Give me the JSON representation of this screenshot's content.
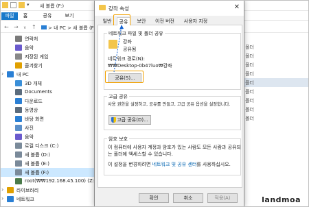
{
  "explorer": {
    "title": "새 볼륨 (F:)",
    "ribbon_tabs": [
      "파일",
      "홈",
      "공유",
      "보기"
    ],
    "address_path": "> 내 PC > 새 볼륨 (F:)",
    "sidebar": [
      {
        "label": "연락처",
        "icon": "contacts-icon",
        "color": "#7a7a7a",
        "indent": 1
      },
      {
        "label": "음악",
        "icon": "music-icon",
        "color": "#6a5acd",
        "indent": 1
      },
      {
        "label": "저장된 게임",
        "icon": "saved-games-icon",
        "color": "#888888",
        "indent": 1
      },
      {
        "label": "즐겨찾기",
        "icon": "favorites-icon",
        "color": "#e0a000",
        "indent": 1
      },
      {
        "label": "내 PC",
        "icon": "pc-icon",
        "color": "#2a7fd4",
        "indent": 0
      },
      {
        "label": "3D 개체",
        "icon": "3d-objects-icon",
        "color": "#3a8fd8",
        "indent": 1
      },
      {
        "label": "Documents",
        "icon": "documents-icon",
        "color": "#5b6c7d",
        "indent": 1
      },
      {
        "label": "다운로드",
        "icon": "downloads-icon",
        "color": "#2a7fd4",
        "indent": 1
      },
      {
        "label": "동영상",
        "icon": "videos-icon",
        "color": "#5b6c7d",
        "indent": 1
      },
      {
        "label": "바탕 화면",
        "icon": "desktop-icon",
        "color": "#2a7fd4",
        "indent": 1
      },
      {
        "label": "사진",
        "icon": "pictures-icon",
        "color": "#5b8fc9",
        "indent": 1
      },
      {
        "label": "음악",
        "icon": "music-icon",
        "color": "#6a5acd",
        "indent": 1
      },
      {
        "label": "로컬 디스크 (C:)",
        "icon": "local-disk-icon",
        "color": "#7a8a9a",
        "indent": 1
      },
      {
        "label": "새 볼륨 (D:)",
        "icon": "drive-icon",
        "color": "#7a8a9a",
        "indent": 1
      },
      {
        "label": "새 볼륨 (E:)",
        "icon": "drive-icon",
        "color": "#7a8a9a",
        "indent": 1
      },
      {
        "label": "새 볼륨 (F:)",
        "icon": "drive-icon",
        "color": "#7a8a9a",
        "indent": 1,
        "selected": true
      },
      {
        "label": "root(₩₩192.168.45.100) (Z:)",
        "icon": "network-drive-icon",
        "color": "#4a7a4a",
        "indent": 1
      },
      {
        "label": "라이브러리",
        "icon": "library-icon",
        "color": "#e0a000",
        "indent": 0
      },
      {
        "label": "네트워크",
        "icon": "network-icon",
        "color": "#2a7fd4",
        "indent": 0
      }
    ],
    "right_column": [
      {
        "label": "파일 폴더",
        "highlighted": false
      },
      {
        "label": "파일 폴더",
        "highlighted": false
      },
      {
        "label": "파일 폴더",
        "highlighted": false
      },
      {
        "label": "파일 폴더",
        "highlighted": false
      },
      {
        "label": "파일 폴더",
        "highlighted": true
      },
      {
        "label": "파일 폴더",
        "highlighted": false
      },
      {
        "label": "파일 폴더",
        "highlighted": false
      },
      {
        "label": "파일 폴더",
        "highlighted": false
      },
      {
        "label": "파일 폴더",
        "highlighted": false
      }
    ]
  },
  "dialog": {
    "title": "강좌 속성",
    "close_glyph": "✕",
    "tabs": [
      "일반",
      "공유",
      "보안",
      "이전 버전",
      "사용자 지정"
    ],
    "active_tab": "공유",
    "network_group": {
      "title": "네트워크 파일 및 폴더 공유",
      "folder_name": "강좌",
      "share_status": "공유됨",
      "path_label": "네트워크 경로(N):",
      "path_value": "₩₩Desktop-0b47luo₩강좌",
      "share_button": "공유(S)..."
    },
    "advanced_group": {
      "title": "고급 공유",
      "description": "사용 권한을 설정하고, 공유를 만들고, 고급 공유 옵션을 설정합니다.",
      "button": "고급 공유(D)..."
    },
    "password_group": {
      "title": "암호 보호",
      "description": "이 컴퓨터에 사용자 계정과 암호가 있는 사람도 모든 사람과 공유되는 폴더에 액세스할 수 있습니다.",
      "settings_prefix": "이 설정을 변경하려면",
      "settings_link": "네트워크 및 공유 센터",
      "settings_suffix": "를 사용하십시오."
    },
    "buttons": {
      "ok": "확인",
      "cancel": "취소",
      "apply": "적용(A)"
    }
  },
  "watermark": "landmoa",
  "colors": {
    "highlight": "#f2a100",
    "file_tab": "#1979ca",
    "link": "#0063b1",
    "selection": "#cce8ff"
  }
}
